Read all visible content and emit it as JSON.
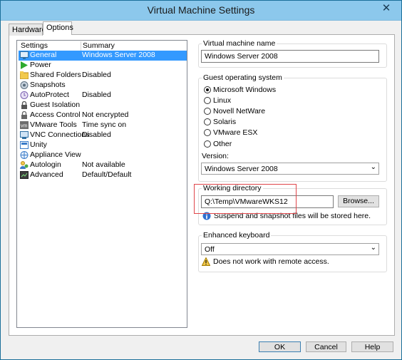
{
  "window": {
    "title": "Virtual Machine Settings",
    "close_glyph": "✕"
  },
  "tabs": [
    {
      "label": "Hardware"
    },
    {
      "label": "Options"
    }
  ],
  "settings": {
    "header_settings": "Settings",
    "header_summary": "Summary",
    "items": [
      {
        "label": "General",
        "summary": "Windows Server 2008",
        "icon": "general-icon",
        "selected": true
      },
      {
        "label": "Power",
        "summary": "",
        "icon": "power-icon"
      },
      {
        "label": "Shared Folders",
        "summary": "Disabled",
        "icon": "shared-folders-icon"
      },
      {
        "label": "Snapshots",
        "summary": "",
        "icon": "snapshots-icon"
      },
      {
        "label": "AutoProtect",
        "summary": "Disabled",
        "icon": "autoprotect-icon"
      },
      {
        "label": "Guest Isolation",
        "summary": "",
        "icon": "guest-isolation-icon"
      },
      {
        "label": "Access Control",
        "summary": "Not encrypted",
        "icon": "access-control-icon"
      },
      {
        "label": "VMware Tools",
        "summary": "Time sync on",
        "icon": "vmware-tools-icon"
      },
      {
        "label": "VNC Connections",
        "summary": "Disabled",
        "icon": "vnc-icon"
      },
      {
        "label": "Unity",
        "summary": "",
        "icon": "unity-icon"
      },
      {
        "label": "Appliance View",
        "summary": "",
        "icon": "appliance-view-icon"
      },
      {
        "label": "Autologin",
        "summary": "Not available",
        "icon": "autologin-icon"
      },
      {
        "label": "Advanced",
        "summary": "Default/Default",
        "icon": "advanced-icon"
      }
    ]
  },
  "vm_name": {
    "label": "Virtual machine name",
    "value": "Windows Server 2008"
  },
  "guest_os": {
    "label": "Guest operating system",
    "options": [
      {
        "label": "Microsoft Windows",
        "selected": true
      },
      {
        "label": "Linux",
        "selected": false
      },
      {
        "label": "Novell NetWare",
        "selected": false
      },
      {
        "label": "Solaris",
        "selected": false
      },
      {
        "label": "VMware ESX",
        "selected": false
      },
      {
        "label": "Other",
        "selected": false
      }
    ],
    "version_label": "Version:",
    "version_value": "Windows Server 2008"
  },
  "working_dir": {
    "label": "Working directory",
    "value": "Q:\\Temp\\VMwareWKS12",
    "browse_label": "Browse...",
    "info": "Suspend and snapshot files will be stored here."
  },
  "enhanced_keyboard": {
    "label": "Enhanced keyboard",
    "value": "Off",
    "warning": "Does not work with remote access."
  },
  "buttons": {
    "ok": "OK",
    "cancel": "Cancel",
    "help": "Help"
  },
  "colors": {
    "selection": "#3399ff",
    "titlebar": "#8cc8ec",
    "highlight_box": "#e0464a"
  }
}
